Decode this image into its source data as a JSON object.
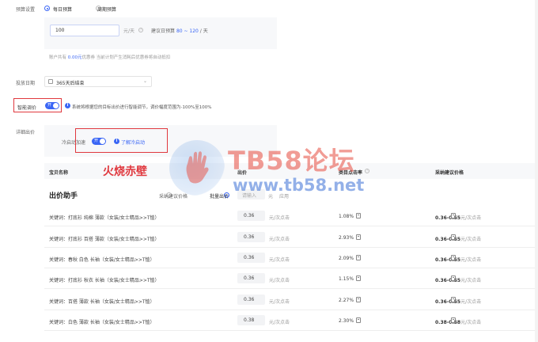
{
  "budget": {
    "label": "预算设置",
    "daily_label": "每日预算",
    "cycle_label": "周期预算",
    "input_value": "100",
    "unit": "元/天",
    "suggest_prefix": "建议日预算",
    "suggest_range": "80 ~ 120",
    "suggest_unit": "/ 天",
    "account_text_prefix": "账户共有",
    "account_amount": "0.00元",
    "account_coupon": "优惠券",
    "account_text_suffix": "当前计划产生消耗后优惠券将自动抵扣"
  },
  "schedule": {
    "label": "投放日期",
    "value": "365天后结束"
  },
  "smart_bid": {
    "label": "智能调价",
    "toggle_text": "开",
    "note": "系统将根据您的目标出价进行智能调节，调价幅度范围为-100%至100%"
  },
  "detail_bid": {
    "label": "详细出价",
    "cold_start_label": "冷启动加速",
    "toggle_text": "开",
    "learn_link": "了解冷启动"
  },
  "overlay": {
    "red_text": "火烧赤壁",
    "watermark_title": "TB58论坛",
    "watermark_url": "www.tb58.net"
  },
  "table": {
    "headers": {
      "name": "宝贝名称",
      "bid": "出价",
      "rate": "类目点击率",
      "suggest": "采纳建议价格"
    },
    "assistant": {
      "title": "出价助手",
      "opt_adopt": "采纳建议价格",
      "opt_batch": "批量出价",
      "batch_input_placeholder": "请输入",
      "unit": "元",
      "apply": "应用"
    },
    "rows": [
      {
        "keyword": "关键词：打底衫 纯棉 薄款（女装/女士精品>>T恤）",
        "bid": "0.36",
        "unit": "元/次点击",
        "rate": "1.08%",
        "suggest": "0.36-0.55",
        "suggest_unit": "元/次点击"
      },
      {
        "keyword": "关键词：打底衫 百搭 薄款（女装/女士精品>>T恤）",
        "bid": "0.36",
        "unit": "元/次点击",
        "rate": "2.93%",
        "suggest": "0.36-0.55",
        "suggest_unit": "元/次点击"
      },
      {
        "keyword": "关键词：春秋 白色 长袖（女装/女士精品>>T恤）",
        "bid": "0.36",
        "unit": "元/次点击",
        "rate": "2.09%",
        "suggest": "0.36-0.55",
        "suggest_unit": "元/次点击"
      },
      {
        "keyword": "关键词：打底衫 秋衣 长袖（女装/女士精品>>T恤）",
        "bid": "0.36",
        "unit": "元/次点击",
        "rate": "1.15%",
        "suggest": "0.36-0.55",
        "suggest_unit": "元/次点击"
      },
      {
        "keyword": "关键词：百搭 薄款 长袖（女装/女士精品>>T恤）",
        "bid": "0.36",
        "unit": "元/次点击",
        "rate": "2.27%",
        "suggest": "0.36-0.55",
        "suggest_unit": "元/次点击"
      },
      {
        "keyword": "关键词：白色 薄款 长袖（女装/女士精品>>T恤）",
        "bid": "0.38",
        "unit": "元/次点击",
        "rate": "2.30%",
        "suggest": "0.38-0.58",
        "suggest_unit": "元/次点击"
      }
    ]
  },
  "colors": {
    "accent": "#3a66f5",
    "annotation_red": "#e0383e",
    "watermark_red": "#e85a4f",
    "watermark_blue": "#3b6fd6"
  }
}
